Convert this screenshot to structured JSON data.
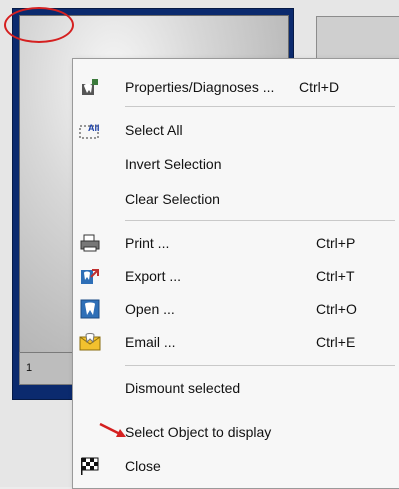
{
  "thumbnail": {
    "number": "1"
  },
  "menu": {
    "items": [
      {
        "name": "properties-diagnoses-item",
        "label": "Properties/Diagnoses ...",
        "shortcut": "Ctrl+D",
        "icon": "tooth-properties-icon"
      },
      {
        "name": "select-all-item",
        "label": "Select All",
        "shortcut": "",
        "icon": "select-all-icon"
      },
      {
        "name": "invert-selection-item",
        "label": "Invert Selection",
        "shortcut": "",
        "icon": ""
      },
      {
        "name": "clear-selection-item",
        "label": "Clear Selection",
        "shortcut": "",
        "icon": ""
      },
      {
        "name": "print-item",
        "label": "Print ...",
        "shortcut": "Ctrl+P",
        "icon": "printer-icon"
      },
      {
        "name": "export-item",
        "label": "Export ...",
        "shortcut": "Ctrl+T",
        "icon": "export-icon"
      },
      {
        "name": "open-item",
        "label": "Open ...",
        "shortcut": "Ctrl+O",
        "icon": "open-tooth-icon"
      },
      {
        "name": "email-item",
        "label": "Email ...",
        "shortcut": "Ctrl+E",
        "icon": "email-icon"
      },
      {
        "name": "dismount-selected-item",
        "label": "Dismount selected",
        "shortcut": "",
        "icon": ""
      },
      {
        "name": "select-object-item",
        "label": "Select Object to display",
        "shortcut": "",
        "icon": ""
      },
      {
        "name": "close-item",
        "label": "Close",
        "shortcut": "",
        "icon": "checkered-flag-icon"
      }
    ],
    "select_all_icon_text": "All"
  },
  "colors": {
    "selection_frame": "#0b2a6e",
    "annotation": "#d52020"
  }
}
